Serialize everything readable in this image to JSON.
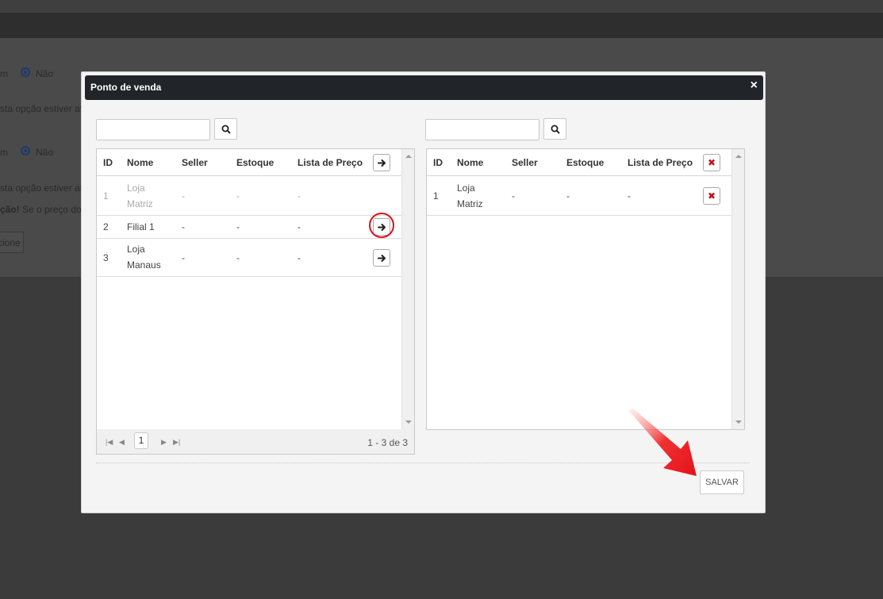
{
  "background": {
    "radio_row1_partial": "m",
    "radio_row1_option": "Não",
    "hint1_partial": "sta opção estiver at",
    "radio_row2_partial": "m",
    "radio_row2_option": "Não",
    "hint2_partial": "sta opção estiver at",
    "warning_bold_partial": "ção!",
    "warning_text_partial": " Se o preço do",
    "button_partial": "cione"
  },
  "modal": {
    "title": "Ponto de venda",
    "close_symbol": "×",
    "save_label": "SALVAR"
  },
  "left_grid": {
    "search_value": "",
    "columns": [
      "ID",
      "Nome",
      "Seller",
      "Estoque",
      "Lista de Preço"
    ],
    "rows": [
      {
        "id": "1",
        "nome_line1": "Loja",
        "nome_line2": "Matriz",
        "seller": "-",
        "estoque": "-",
        "lista": "-",
        "disabled": true
      },
      {
        "id": "2",
        "nome_line1": "Filial 1",
        "nome_line2": "",
        "seller": "-",
        "estoque": "-",
        "lista": "-",
        "disabled": false
      },
      {
        "id": "3",
        "nome_line1": "Loja",
        "nome_line2": "Manaus",
        "seller": "-",
        "estoque": "-",
        "lista": "-",
        "disabled": false
      }
    ],
    "pager": {
      "current_page": "1",
      "info": "1 - 3 de 3",
      "first_icon": "first-page-icon",
      "prev_icon": "prev-page-icon",
      "next_icon": "next-page-icon",
      "last_icon": "last-page-icon"
    }
  },
  "right_grid": {
    "search_value": "",
    "columns": [
      "ID",
      "Nome",
      "Seller",
      "Estoque",
      "Lista de Preço"
    ],
    "rows": [
      {
        "id": "1",
        "nome_line1": "Loja",
        "nome_line2": "Matriz",
        "seller": "-",
        "estoque": "-",
        "lista": "-"
      }
    ]
  },
  "colors": {
    "header_bg": "#212529",
    "remove_red": "#c0141e",
    "annotation_red": "#e4121b"
  }
}
